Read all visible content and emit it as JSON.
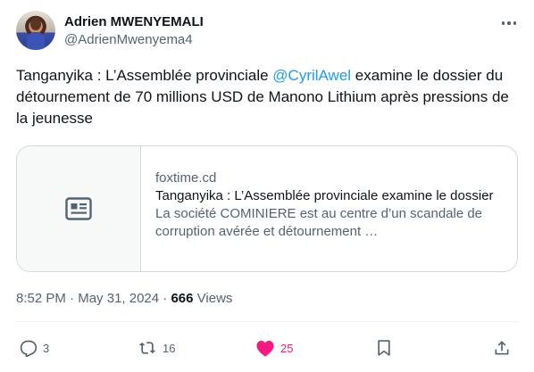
{
  "author": {
    "display_name": "Adrien MWENYEMALI",
    "handle": "@AdrienMwenyema4"
  },
  "tweet": {
    "text_before": "Tanganyika : L’Assemblée provinciale ",
    "mention": "@CyrilAwel",
    "text_after": "  examine le dossier du détournement de 70 millions USD de Manono Lithium après pressions de la jeunesse"
  },
  "card": {
    "domain": "foxtime.cd",
    "title": "Tanganyika : L’Assemblée provinciale examine le dossier",
    "description": "La société COMINIERE est au centre d’un scandale de corruption avérée et détournement …",
    "thumb_icon": "article-icon"
  },
  "meta": {
    "time": "8:52 PM",
    "separator": " · ",
    "date": "May 31, 2024",
    "views_count": "666",
    "views_label": " Views"
  },
  "actions": {
    "reply_count": "3",
    "retweet_count": "16",
    "like_count": "25",
    "like_color": "#f91880"
  },
  "colors": {
    "link": "#1d9bf0",
    "secondary": "#536471",
    "border": "#cfd9de"
  }
}
